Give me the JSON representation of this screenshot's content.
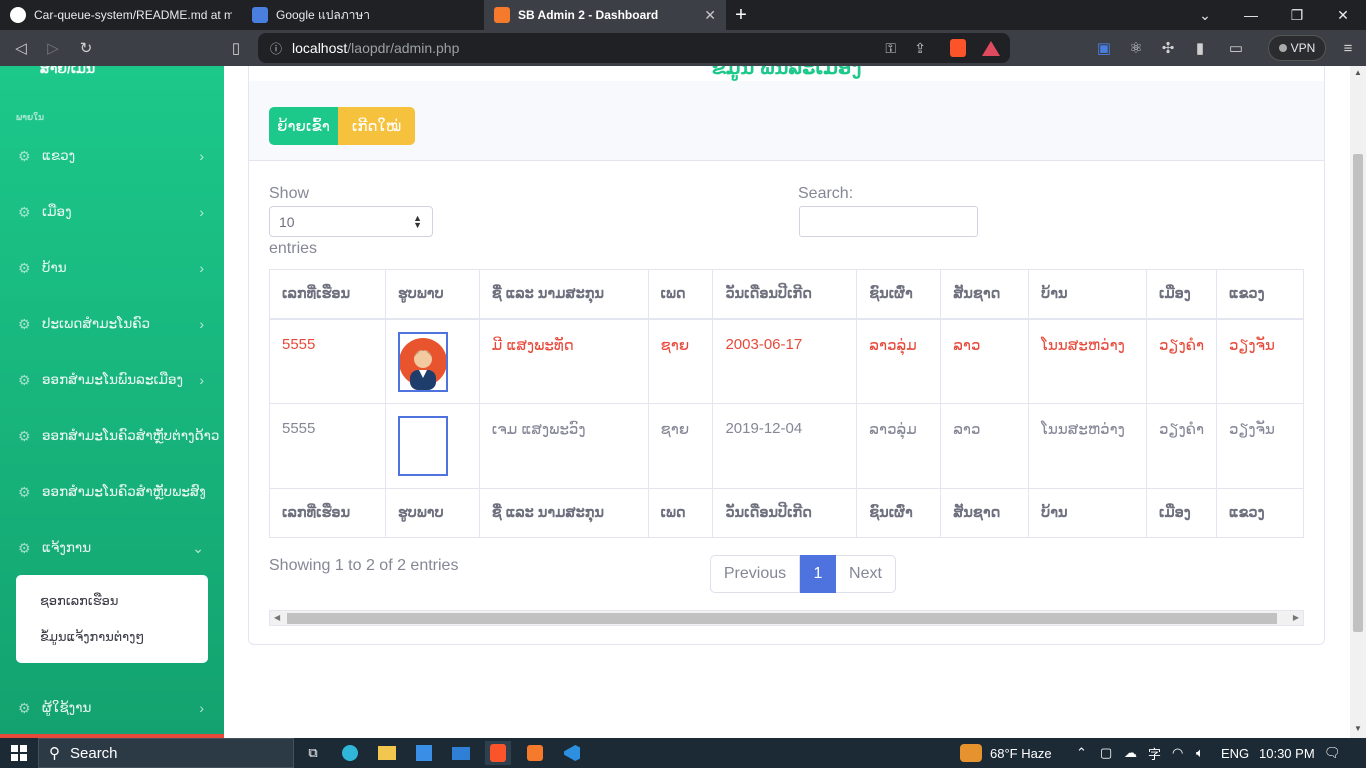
{
  "browser": {
    "tabs": [
      {
        "title": "Car-queue-system/README.md at ma",
        "active": false,
        "favicon": "github-icon"
      },
      {
        "title": "Google แปลภาษา",
        "active": false,
        "favicon": "translate-icon"
      },
      {
        "title": "SB Admin 2 - Dashboard",
        "active": true,
        "favicon": "xampp-icon"
      }
    ],
    "new_tab": "+",
    "url_host": "localhost",
    "url_path": "/laopdr/admin.php",
    "vpn_label": "VPN"
  },
  "sidebar": {
    "brand": "ສາຍ/ເມນ",
    "heading": "ພາຍໃນ",
    "items": [
      {
        "label": "ແຂວງ"
      },
      {
        "label": "ເມືອງ"
      },
      {
        "label": "ບ້ານ"
      },
      {
        "label": "ປະເພດສຳມະໂນຄົວ"
      },
      {
        "label": "ອອກສຳມະໂນພົນລະເມືອງ"
      },
      {
        "label": "ອອກສຳມະໂນຄົວສຳຫຼັບຕ່າງດ້າວ"
      },
      {
        "label": "ອອກສຳມະໂນຄົວສຳຫຼັບພະສົງ"
      },
      {
        "label": "ແຈ້ງການ"
      },
      {
        "label": "ຜູ້ໃຊ້ງານ"
      }
    ],
    "submenu": [
      {
        "label": "ຊອກເລກເຮືອນ"
      },
      {
        "label": "ຂໍ້ມູນແຈ້ງການຕ່າງໆ"
      }
    ]
  },
  "main": {
    "title": "ຂໍ້ມູນ ພົນລະເມືອງ",
    "move_in_button": "ຍ້າຍເຂົ້າ",
    "new_birth_button": "ເກີດໃໝ່",
    "show_label": "Show",
    "entries_select": "10",
    "entries_label": "entries",
    "search_label": "Search:",
    "search_value": "",
    "table": {
      "headers": [
        "ເລກທີ່ເຮືອນ",
        "ຮູບພາບ",
        "ຊື່ ແລະ ນາມສະກຸນ",
        "ເພດ",
        "ວັນເດືອນປີເກີດ",
        "ຊົນເຜົ່າ",
        "ສັນຊາດ",
        "ບ້ານ",
        "ເມືອງ",
        "ແຂວງ"
      ],
      "rows": [
        {
          "house_no": "5555",
          "name": "ມີ ແສງພະທັດ",
          "gender": "ຊາຍ",
          "dob": "2003-06-17",
          "ethnic": "ລາວລຸ່ມ",
          "nationality": "ລາວ",
          "village": "ໂນນສະຫວ່າງ",
          "district": "ວຽງຄຳ",
          "province": "ວຽງຈັນ",
          "highlight": true
        },
        {
          "house_no": "5555",
          "name": "ເຈມ ແສງພະວົງ",
          "gender": "ຊາຍ",
          "dob": "2019-12-04",
          "ethnic": "ລາວລຸ່ມ",
          "nationality": "ລາວ",
          "village": "ໂນນສະຫວ່າງ",
          "district": "ວຽງຄຳ",
          "province": "ວຽງຈັນ",
          "highlight": false
        }
      ]
    },
    "showing_text": "Showing 1 to 2 of 2 entries",
    "pagination": {
      "prev": "Previous",
      "current": "1",
      "next": "Next"
    }
  },
  "taskbar": {
    "search_label": "Search",
    "weather": "68°F  Haze",
    "lang": "ENG",
    "time": "10:30 PM"
  },
  "colors": {
    "accent": "#1cc88a",
    "warning": "#f6c23e",
    "danger": "#e74a3b",
    "primary": "#4e73df"
  }
}
